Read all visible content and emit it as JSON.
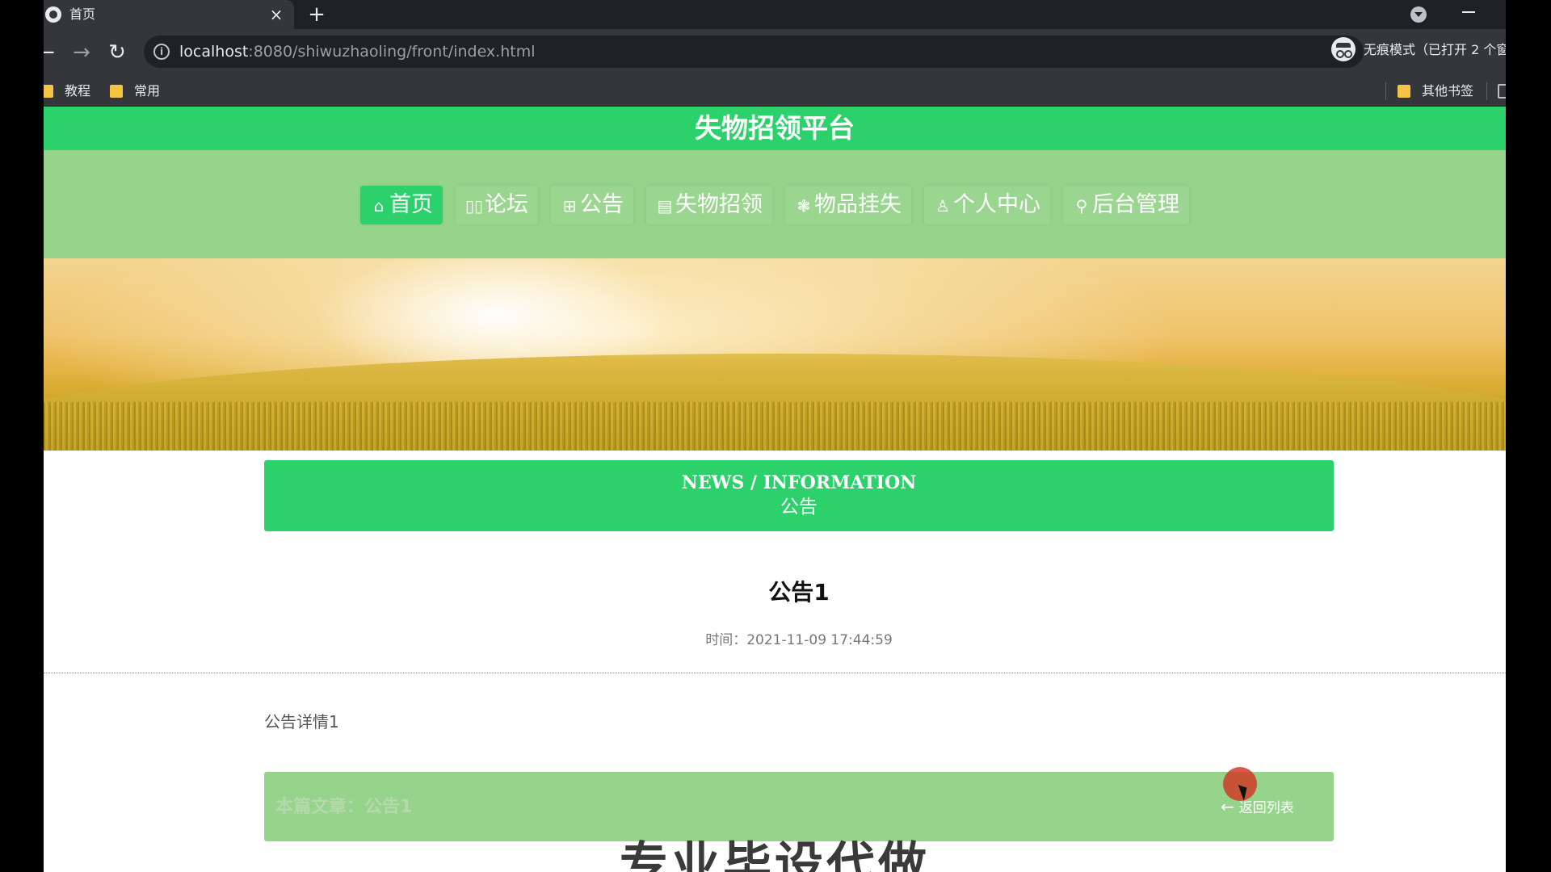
{
  "browser": {
    "tab_title": "首页",
    "tab_close": "×",
    "new_tab": "+",
    "url_host": "localhost",
    "url_path": ":8080/shiwuzhaoling/front/index.html",
    "incognito_label": "无痕模式（已打开 2 个窗",
    "bookmarks": [
      "教程",
      "常用"
    ],
    "other_bookmarks": "其他书签"
  },
  "site": {
    "title": "失物招领平台",
    "nav": [
      {
        "icon": "⌂",
        "label": "首页",
        "active": true
      },
      {
        "icon": "▯▯",
        "label": "论坛"
      },
      {
        "icon": "⊞",
        "label": "公告"
      },
      {
        "icon": "▤",
        "label": "失物招领"
      },
      {
        "icon": "❃",
        "label": "物品挂失"
      },
      {
        "icon": "♙",
        "label": "个人中心"
      },
      {
        "icon": "⚲",
        "label": "后台管理"
      }
    ],
    "carousel": {
      "slides": 3,
      "active_index": 0
    }
  },
  "section": {
    "title_en": "NEWS / INFORMATION",
    "title_cn": "公告"
  },
  "article": {
    "title": "公告1",
    "time": "时间：2021-11-09 17:44:59",
    "body": "公告详情1",
    "current_label": "本篇文章：公告1",
    "back_label": "返回列表"
  },
  "overlay": {
    "watermark": "专业毕设代做"
  },
  "colors": {
    "accent_green": "#2dd16b",
    "light_green": "#95d48a"
  }
}
